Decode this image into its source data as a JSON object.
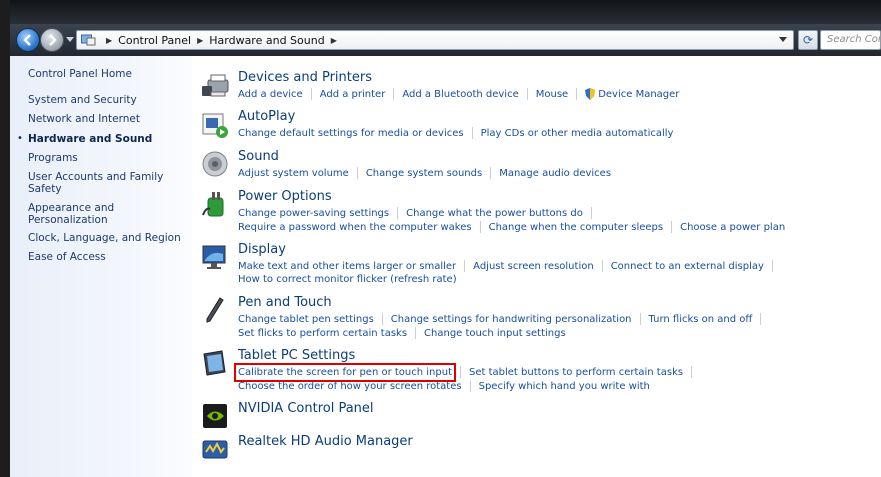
{
  "address": {
    "crumbs": [
      "Control Panel",
      "Hardware and Sound"
    ],
    "search_placeholder": "Search Control Panel"
  },
  "sidebar": {
    "items": [
      {
        "label": "Control Panel Home"
      },
      {
        "label": "System and Security"
      },
      {
        "label": "Network and Internet"
      },
      {
        "label": "Hardware and Sound",
        "active": true
      },
      {
        "label": "Programs"
      },
      {
        "label": "User Accounts and Family Safety"
      },
      {
        "label": "Appearance and Personalization"
      },
      {
        "label": "Clock, Language, and Region"
      },
      {
        "label": "Ease of Access"
      }
    ]
  },
  "categories": [
    {
      "title": "Devices and Printers",
      "icon": "printer-icon",
      "lines": [
        [
          "Add a device",
          "Add a printer",
          "Add a Bluetooth device",
          "Mouse",
          "Device Manager"
        ]
      ]
    },
    {
      "title": "AutoPlay",
      "icon": "autoplay-icon",
      "lines": [
        [
          "Change default settings for media or devices",
          "Play CDs or other media automatically"
        ]
      ]
    },
    {
      "title": "Sound",
      "icon": "speaker-icon",
      "lines": [
        [
          "Adjust system volume",
          "Change system sounds",
          "Manage audio devices"
        ]
      ]
    },
    {
      "title": "Power Options",
      "icon": "power-icon",
      "lines": [
        [
          "Change power-saving settings",
          "Change what the power buttons do"
        ],
        [
          "Require a password when the computer wakes",
          "Change when the computer sleeps",
          "Choose a power plan"
        ]
      ]
    },
    {
      "title": "Display",
      "icon": "display-icon",
      "lines": [
        [
          "Make text and other items larger or smaller",
          "Adjust screen resolution",
          "Connect to an external display"
        ],
        [
          "How to correct monitor flicker (refresh rate)"
        ]
      ]
    },
    {
      "title": "Pen and Touch",
      "icon": "pen-icon",
      "lines": [
        [
          "Change tablet pen settings",
          "Change settings for handwriting personalization",
          "Turn flicks on and off"
        ],
        [
          "Set flicks to perform certain tasks",
          "Change touch input settings"
        ]
      ]
    },
    {
      "title": "Tablet PC Settings",
      "icon": "tablet-icon",
      "lines": [
        [
          "Calibrate the screen for pen or touch input",
          "Set tablet buttons to perform certain tasks"
        ],
        [
          "Choose the order of how your screen rotates",
          "Specify which hand you write with"
        ]
      ]
    },
    {
      "title": "NVIDIA Control Panel",
      "icon": "nvidia-icon",
      "lines": []
    },
    {
      "title": "Realtek HD Audio Manager",
      "icon": "realtek-icon",
      "lines": []
    }
  ],
  "highlight": {
    "link": "Calibrate the screen for pen or touch input",
    "color": "#e00000"
  }
}
